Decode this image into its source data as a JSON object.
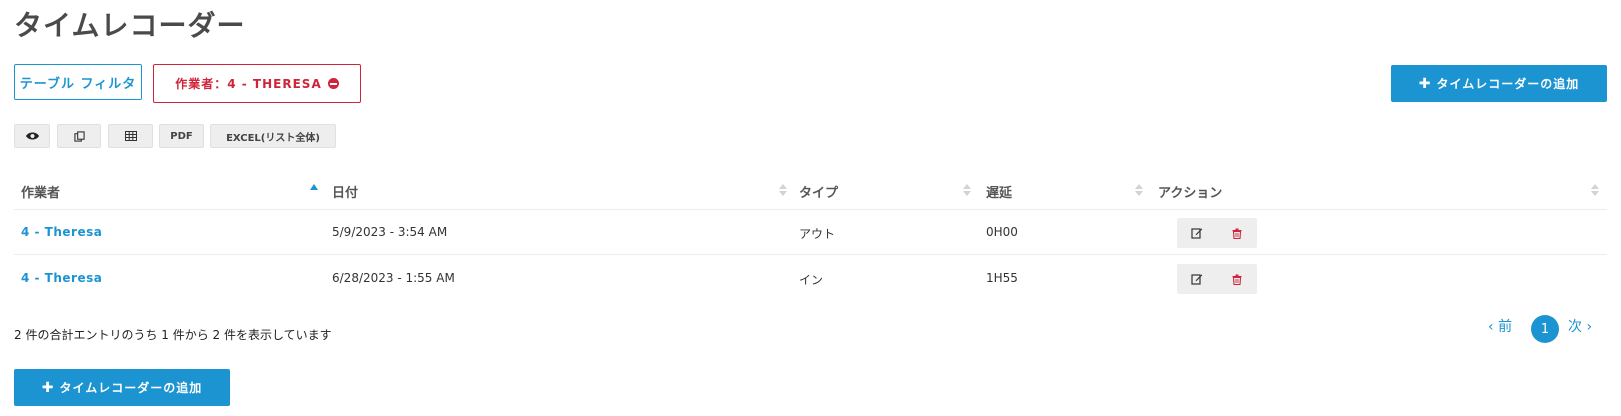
{
  "page": {
    "title": "タイムレコーダー"
  },
  "filters": {
    "table_filter_label": "テーブル フィルタ",
    "active_filter_label": "作業者：4 - THERESA"
  },
  "actions": {
    "add_label": "タイムレコーダーの追加"
  },
  "toolbar": {
    "pdf_label": "PDF",
    "excel_label": "EXCEL(リスト全体)"
  },
  "table": {
    "columns": [
      "作業者",
      "日付",
      "タイプ",
      "遅延",
      "アクション"
    ],
    "rows": [
      {
        "worker": "4 - Theresa",
        "date": "5/9/2023 - 3:54 AM",
        "type": "アウト",
        "delay": "0H00"
      },
      {
        "worker": "4 - Theresa",
        "date": "6/28/2023 - 1:55 AM",
        "type": "イン",
        "delay": "1H55"
      }
    ]
  },
  "footer": {
    "info": "2 件の合計エントリのうち 1 件から 2 件を表示しています",
    "prev_label": "前",
    "current_page": "1",
    "next_label": "次"
  },
  "colors": {
    "accent": "#1c94d2",
    "danger": "#d0243a"
  }
}
